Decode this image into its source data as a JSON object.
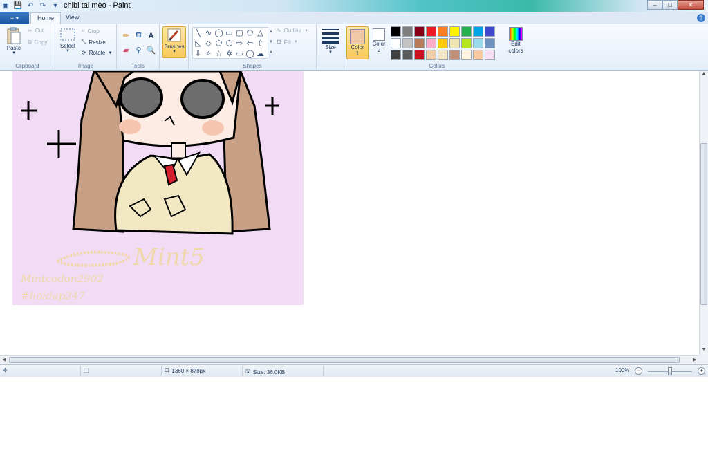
{
  "titlebar": {
    "title": "chibi tai mèo - Paint",
    "controls": {
      "minimize": "–",
      "maximize": "□",
      "close": "✕"
    }
  },
  "quick_access": [
    "save-icon",
    "undo-icon",
    "redo-icon",
    "customize-icon"
  ],
  "tabs": {
    "file": "≡ ▾",
    "home": "Home",
    "view": "View",
    "help": "?"
  },
  "ribbon": {
    "clipboard": {
      "paste": "Paste",
      "cut": "Cut",
      "copy": "Copy",
      "label": "Clipboard"
    },
    "image": {
      "select": "Select",
      "crop": "Crop",
      "resize": "Resize",
      "rotate": "Rotate",
      "label": "Image"
    },
    "tools": {
      "label": "Tools"
    },
    "brushes": {
      "label": "Brushes"
    },
    "shapes": {
      "outline": "Outline",
      "fill": "Fill",
      "label": "Shapes"
    },
    "size": {
      "label": "Size"
    },
    "colors": {
      "color1_label": "Color",
      "color1_num": "1",
      "color2_label": "Color",
      "color2_num": "2",
      "color1": "#f0c9a4",
      "color2": "#ffffff",
      "edit_label": "Edit colors",
      "label": "Colors",
      "palette": [
        "#000000",
        "#7f7f7f",
        "#880015",
        "#ed1c24",
        "#ff7f27",
        "#fff200",
        "#22b14c",
        "#00a2e8",
        "#3f48cc",
        "#a349a4",
        "#ffffff",
        "#c3c3c3",
        "#b97a57",
        "#ffaec9",
        "#ffc90e",
        "#efe4b0",
        "#b5e61d",
        "#99d9ea",
        "#7092be",
        "#c8bfe7",
        "#404040",
        "#5a5a5a",
        "#cc1020",
        "#f2cda8",
        "#f5e6c8",
        "#c0907a",
        "#fff4e0",
        "#f7c9a0",
        "#f8e0f3",
        "#e8ecf0"
      ]
    }
  },
  "canvas": {
    "background": "#f1dbf5",
    "watermark_name": "Mintcodon2902",
    "watermark_tag": "#hoidap247",
    "signature": "Mint5"
  },
  "statusbar": {
    "dimensions": "1360 × 878px",
    "size": "Size: 36.0KB",
    "zoom": "100%"
  }
}
